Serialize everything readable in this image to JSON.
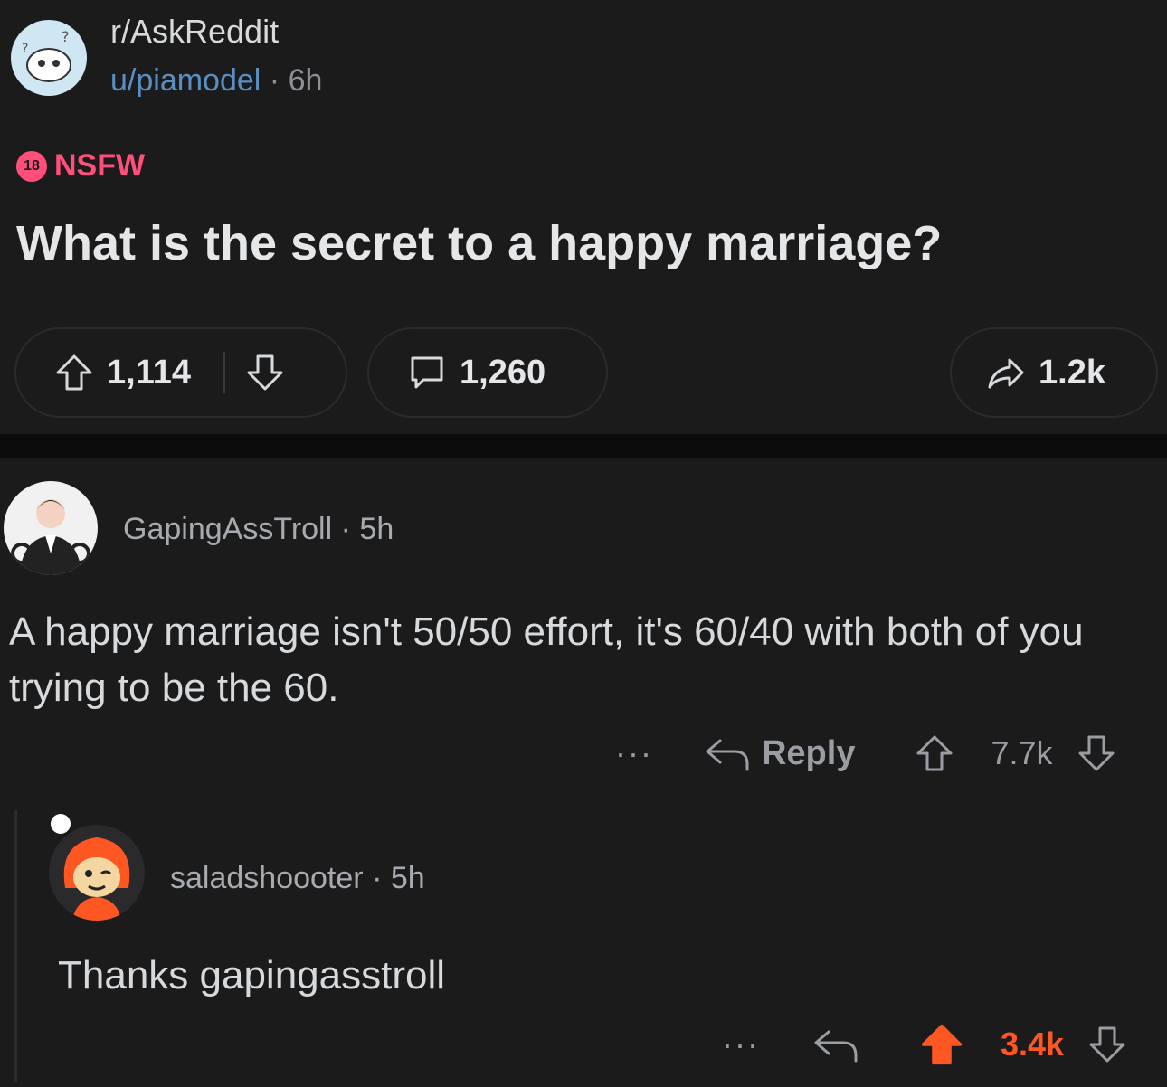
{
  "post": {
    "subreddit": "r/AskReddit",
    "author": "u/piamodel",
    "separator": "·",
    "age": "6h",
    "nsfw_badge": "18",
    "nsfw_label": "NSFW",
    "title": "What is the secret to a happy marriage?",
    "upvotes": "1,114",
    "comments": "1,260",
    "shares": "1.2k"
  },
  "comments": [
    {
      "author": "GapingAssTroll",
      "separator": "·",
      "age": "5h",
      "body": "A happy marriage isn't 50/50 effort, it's 60/40 with both of you trying to be the 60.",
      "more": "···",
      "reply_label": "Reply",
      "score": "7.7k"
    },
    {
      "author": "saladshoooter",
      "separator": "·",
      "age": "5h",
      "body": "Thanks gapingasstroll",
      "more": "···",
      "score": "3.4k"
    }
  ],
  "colors": {
    "background": "#1b1b1c",
    "nsfw": "#ff4f7a",
    "upvoted": "#ff5722",
    "username_link": "#5b8fc4"
  },
  "icons": [
    "subreddit-avatar",
    "upvote-icon",
    "downvote-icon",
    "comment-icon",
    "share-icon",
    "reply-icon",
    "user-avatar"
  ]
}
